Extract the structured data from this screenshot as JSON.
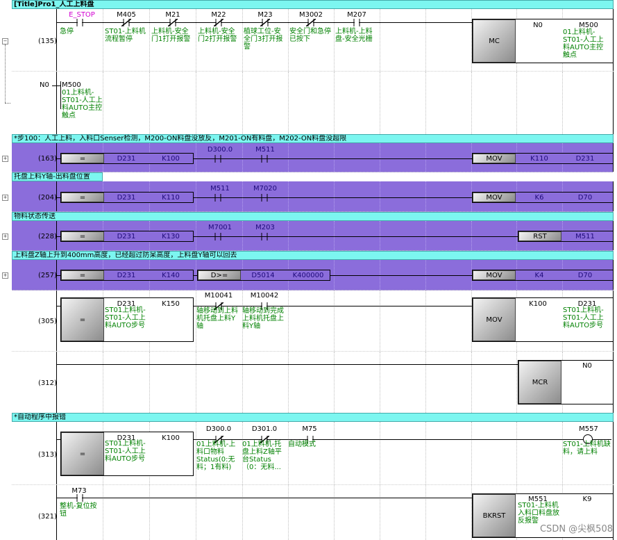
{
  "title_comment": "[Title]Pro1_人工上料盘",
  "comments": {
    "c163": "*步100：人工上料，入料口Senser检测，M200-ON料盘没放反，M201-ON有料盘，M202-ON料盘没超限",
    "c204": "托盘上料Y轴-出料盘位置",
    "c228": "物料状态传送",
    "c257": "上料盘Z轴上升到400mm高度，已经超过防呆高度，上料盘Y轴可以回去",
    "c313": "*自动程序中报错"
  },
  "rungs": {
    "r135": {
      "step": "(135)",
      "contacts": [
        {
          "dev": "E_STOP",
          "cmt": "急停"
        },
        {
          "dev": "M405",
          "cmt": "ST01-上料机流程暂停"
        },
        {
          "dev": "M21",
          "cmt": "上料机-安全门1打开报警"
        },
        {
          "dev": "M22",
          "cmt": "上料机-安全门2打开报警"
        },
        {
          "dev": "M23",
          "cmt": "植球工位-安全门3打开报警"
        },
        {
          "dev": "M3002",
          "cmt": "安全门和急停已按下"
        },
        {
          "dev": "M207",
          "cmt": "上料机-上料盘-安全光栅"
        }
      ],
      "instr": "MC",
      "p1": "N0",
      "p2": "M500",
      "p2cmt": "01上料机-ST01-人工上料AUTO主控触点"
    },
    "r_n0": {
      "label": "N0",
      "dev": "M500",
      "cmt": "01上料机-ST01-人工上料AUTO主控触点"
    },
    "r163": {
      "step": "(163)",
      "cmp": "=",
      "a": "D231",
      "b": "K100",
      "c1": "D300.0",
      "c2": "M511",
      "instr": "MOV",
      "s": "K110",
      "d": "D231"
    },
    "r204": {
      "step": "(204)",
      "cmp": "=",
      "a": "D231",
      "b": "K110",
      "c1": "M511",
      "c2": "M7020",
      "instr": "MOV",
      "s": "K6",
      "d": "D70"
    },
    "r228": {
      "step": "(228)",
      "cmp": "=",
      "a": "D231",
      "b": "K130",
      "c1": "M7001",
      "c2": "M203",
      "instr": "RST",
      "d": "M511"
    },
    "r257": {
      "step": "(257)",
      "cmp": "=",
      "a": "D231",
      "b": "K140",
      "cmp2": "D>=",
      "a2": "D5014",
      "b2": "K400000",
      "instr": "MOV",
      "s": "K4",
      "d": "D70"
    },
    "r305": {
      "step": "(305)",
      "cmp": "=",
      "a": "D231",
      "acmt": "ST01上料机-ST01-人工上料AUTO步号",
      "b": "K150",
      "c1": "M10041",
      "c1cmt": "轴移动到上料机托盘上料Y轴",
      "c2": "M10042",
      "c2cmt": "轴移动到完成上料机托盘上料Y轴",
      "instr": "MOV",
      "s": "K100",
      "d": "D231",
      "dcmt": "ST01上料机-ST01-人工上料AUTO步号"
    },
    "r312": {
      "step": "(312)",
      "instr": "MCR",
      "p1": "N0"
    },
    "r313": {
      "step": "(313)",
      "cmp": "=",
      "a": "D231",
      "acmt": "ST01上料机-ST01-人工上料AUTO步号",
      "b": "K100",
      "c1": "D300.0",
      "c1cmt": "01上料机-上料口物料Status(0:无料；1有料)",
      "c2": "D301.0",
      "c2cmt": "01上料机-托盘上料Z轴平台Status（0：无料...",
      "c3": "M75",
      "c3cmt": "自动模式",
      "coil": "M557",
      "coilcmt": "ST01-上料机缺料，请上料"
    },
    "r321": {
      "step": "(321)",
      "c1": "M73",
      "c1cmt": "整机-复位按钮",
      "instr": "BKRST",
      "s": "M551",
      "scmt": "ST01-上料机入料口料盘放反报警",
      "d": "K9"
    }
  },
  "watermark": "CSDN @尖枫508"
}
